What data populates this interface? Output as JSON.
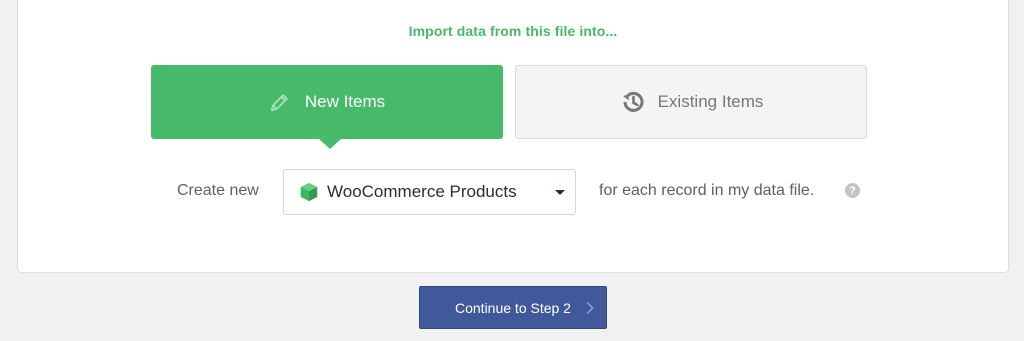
{
  "import": {
    "heading": "Import data from this file into...",
    "new_items": {
      "label": "New Items",
      "icon": "pencil-icon",
      "selected": true
    },
    "existing_items": {
      "label": "Existing Items",
      "icon": "history-icon",
      "selected": false
    }
  },
  "create_row": {
    "prefix": "Create new",
    "post_type": {
      "selected": "WooCommerce Products",
      "icon": "cube-icon"
    },
    "suffix": "for each record in my data file.",
    "help_glyph": "?"
  },
  "continue_button": {
    "label": "Continue to Step 2",
    "icon": "chevron-right-icon"
  },
  "colors": {
    "accent_green": "#46ba69",
    "button_blue": "#41599a",
    "cube_green": "#3fb463"
  }
}
